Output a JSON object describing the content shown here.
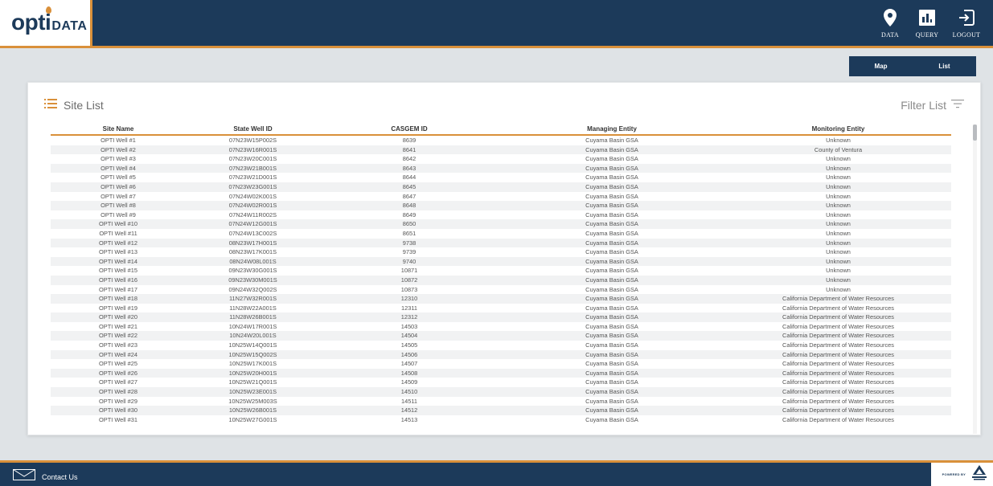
{
  "brand": {
    "main": "opti",
    "sub": "DATA"
  },
  "nav": [
    {
      "label": "DATA",
      "icon": "map-pin-icon"
    },
    {
      "label": "QUERY",
      "icon": "bar-chart-icon"
    },
    {
      "label": "LOGOUT",
      "icon": "logout-icon"
    }
  ],
  "view_toggle": {
    "map": "Map",
    "list": "List"
  },
  "card": {
    "title": "Site List",
    "filter_label": "Filter List"
  },
  "table": {
    "columns": [
      "Site Name",
      "State Well ID",
      "CASGEM ID",
      "Managing Entity",
      "Monitoring Entity"
    ],
    "rows": [
      [
        "OPTI Well #1",
        "07N23W15P002S",
        "8639",
        "Cuyama Basin GSA",
        "Unknown"
      ],
      [
        "OPTI Well #2",
        "07N23W16R001S",
        "8641",
        "Cuyama Basin GSA",
        "County of Ventura"
      ],
      [
        "OPTI Well #3",
        "07N23W20C001S",
        "8642",
        "Cuyama Basin GSA",
        "Unknown"
      ],
      [
        "OPTI Well #4",
        "07N23W21B001S",
        "8643",
        "Cuyama Basin GSA",
        "Unknown"
      ],
      [
        "OPTI Well #5",
        "07N23W21D001S",
        "8644",
        "Cuyama Basin GSA",
        "Unknown"
      ],
      [
        "OPTI Well #6",
        "07N23W23G001S",
        "8645",
        "Cuyama Basin GSA",
        "Unknown"
      ],
      [
        "OPTI Well #7",
        "07N24W02K001S",
        "8647",
        "Cuyama Basin GSA",
        "Unknown"
      ],
      [
        "OPTI Well #8",
        "07N24W02R001S",
        "8648",
        "Cuyama Basin GSA",
        "Unknown"
      ],
      [
        "OPTI Well #9",
        "07N24W11R002S",
        "8649",
        "Cuyama Basin GSA",
        "Unknown"
      ],
      [
        "OPTI Well #10",
        "07N24W12G001S",
        "8650",
        "Cuyama Basin GSA",
        "Unknown"
      ],
      [
        "OPTI Well #11",
        "07N24W13C002S",
        "8651",
        "Cuyama Basin GSA",
        "Unknown"
      ],
      [
        "OPTI Well #12",
        "08N23W17H001S",
        "9738",
        "Cuyama Basin GSA",
        "Unknown"
      ],
      [
        "OPTI Well #13",
        "08N23W17K001S",
        "9739",
        "Cuyama Basin GSA",
        "Unknown"
      ],
      [
        "OPTI Well #14",
        "08N24W08L001S",
        "9740",
        "Cuyama Basin GSA",
        "Unknown"
      ],
      [
        "OPTI Well #15",
        "09N23W30G001S",
        "10871",
        "Cuyama Basin GSA",
        "Unknown"
      ],
      [
        "OPTI Well #16",
        "09N23W30M001S",
        "10872",
        "Cuyama Basin GSA",
        "Unknown"
      ],
      [
        "OPTI Well #17",
        "09N24W32Q002S",
        "10873",
        "Cuyama Basin GSA",
        "Unknown"
      ],
      [
        "OPTI Well #18",
        "11N27W32R001S",
        "12310",
        "Cuyama Basin GSA",
        "California Department of Water Resources"
      ],
      [
        "OPTI Well #19",
        "11N28W22A001S",
        "12311",
        "Cuyama Basin GSA",
        "California Department of Water Resources"
      ],
      [
        "OPTI Well #20",
        "11N28W26B001S",
        "12312",
        "Cuyama Basin GSA",
        "California Department of Water Resources"
      ],
      [
        "OPTI Well #21",
        "10N24W17R001S",
        "14503",
        "Cuyama Basin GSA",
        "California Department of Water Resources"
      ],
      [
        "OPTI Well #22",
        "10N24W20L001S",
        "14504",
        "Cuyama Basin GSA",
        "California Department of Water Resources"
      ],
      [
        "OPTI Well #23",
        "10N25W14Q001S",
        "14505",
        "Cuyama Basin GSA",
        "California Department of Water Resources"
      ],
      [
        "OPTI Well #24",
        "10N25W15Q002S",
        "14506",
        "Cuyama Basin GSA",
        "California Department of Water Resources"
      ],
      [
        "OPTI Well #25",
        "10N25W17K001S",
        "14507",
        "Cuyama Basin GSA",
        "California Department of Water Resources"
      ],
      [
        "OPTI Well #26",
        "10N25W20H001S",
        "14508",
        "Cuyama Basin GSA",
        "California Department of Water Resources"
      ],
      [
        "OPTI Well #27",
        "10N25W21Q001S",
        "14509",
        "Cuyama Basin GSA",
        "California Department of Water Resources"
      ],
      [
        "OPTI Well #28",
        "10N25W23E001S",
        "14510",
        "Cuyama Basin GSA",
        "California Department of Water Resources"
      ],
      [
        "OPTI Well #29",
        "10N25W25M003S",
        "14511",
        "Cuyama Basin GSA",
        "California Department of Water Resources"
      ],
      [
        "OPTI Well #30",
        "10N25W26B001S",
        "14512",
        "Cuyama Basin GSA",
        "California Department of Water Resources"
      ],
      [
        "OPTI Well #31",
        "10N25W27G001S",
        "14513",
        "Cuyama Basin GSA",
        "California Department of Water Resources"
      ]
    ]
  },
  "footer": {
    "contact": "Contact Us",
    "powered_by": "POWERED BY"
  },
  "colors": {
    "navy": "#1c3a5a",
    "accent": "#d9903a"
  }
}
